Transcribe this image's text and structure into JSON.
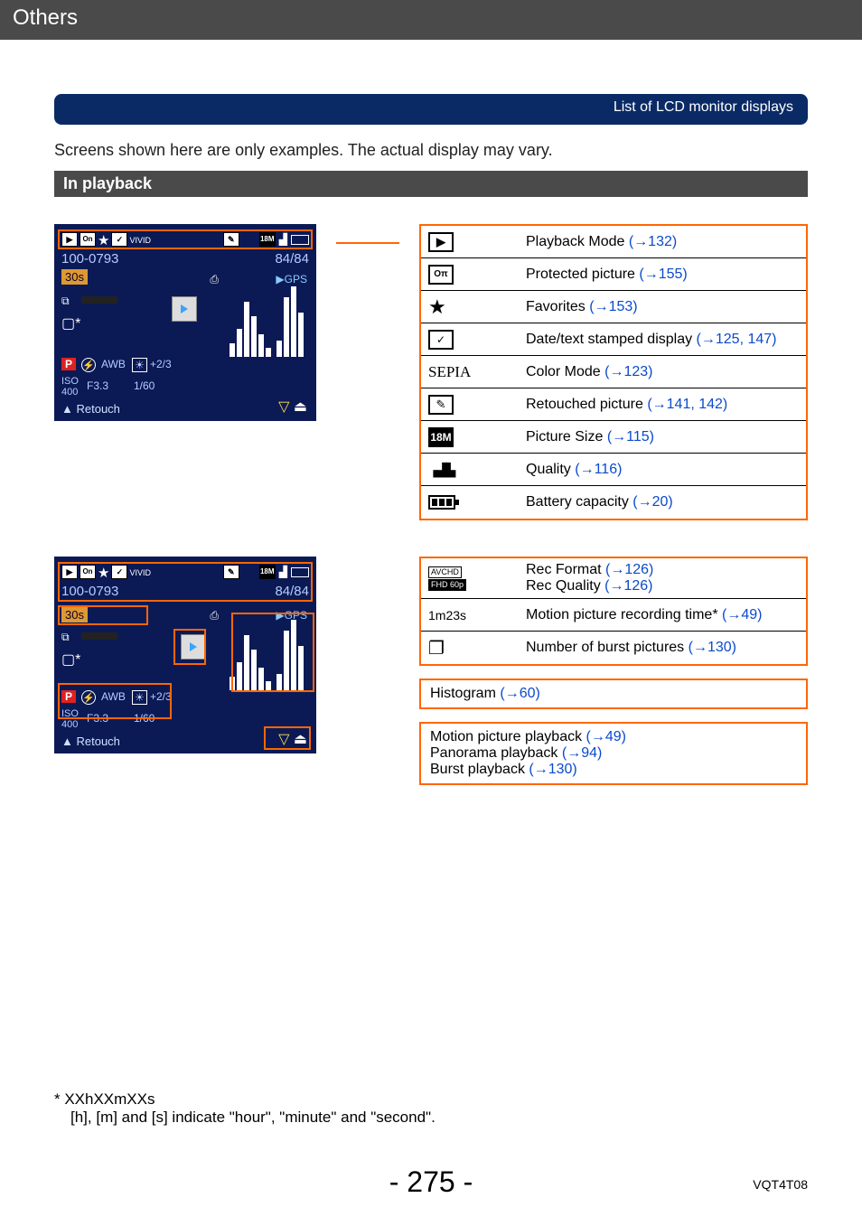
{
  "header": "Others",
  "blueBar": "List of LCD monitor displays",
  "intro": "Screens shown here are only examples. The actual display may vary.",
  "sectionTitle": "In playback",
  "screenshot1": {
    "folder": "100-0793",
    "count": "84/84",
    "duration": "30s",
    "gps": "GPS",
    "mode": "P",
    "awb": "AWB",
    "ev": "+2/3",
    "iso": "400",
    "fnum": "F3.3",
    "shutter": "1/60",
    "retouch": "▲ Retouch",
    "vivid": "VIVID",
    "eighteen": "18M"
  },
  "table1": [
    {
      "iconType": "play",
      "label": "Playback Mode ",
      "ref": "(→132)"
    },
    {
      "iconType": "on",
      "label": "Protected picture ",
      "ref": "(→155)"
    },
    {
      "iconType": "star",
      "label": "Favorites ",
      "ref": "(→153)"
    },
    {
      "iconType": "stamp",
      "label": "Date/text stamped display ",
      "ref": "(→125, 147)"
    },
    {
      "iconType": "sepia",
      "iconText": "SEPIA",
      "label": "Color Mode ",
      "ref": "(→123)"
    },
    {
      "iconType": "retouch",
      "label": "Retouched picture ",
      "ref": "(→141, 142)"
    },
    {
      "iconType": "18m",
      "iconText": "18M",
      "label": "Picture Size ",
      "ref": "(→115)"
    },
    {
      "iconType": "quality",
      "label": "Quality ",
      "ref": "(→116)"
    },
    {
      "iconType": "battery",
      "label": "Battery capacity ",
      "ref": "(→20)"
    }
  ],
  "table2": [
    {
      "iconType": "avchd",
      "iconText1": "AVCHD",
      "iconText2": "FHD 60p",
      "label1": "Rec Format ",
      "ref1": "(→126)",
      "label2": "Rec Quality ",
      "ref2": "(→126)"
    },
    {
      "iconType": "text",
      "iconText": "1m23s",
      "label": "Motion picture recording time* ",
      "ref": "(→49)"
    },
    {
      "iconType": "burst",
      "label": "Number of burst pictures ",
      "ref": "(→130)"
    }
  ],
  "histBox": {
    "label": "Histogram ",
    "ref": "(→60)"
  },
  "playbackBox": [
    {
      "label": "Motion picture playback ",
      "ref": "(→49)"
    },
    {
      "label": "Panorama playback ",
      "ref": "(→94)"
    },
    {
      "label": "Burst playback ",
      "ref": "(→130)"
    }
  ],
  "footnote1": "* XXhXXmXXs",
  "footnote2": "[h], [m] and [s] indicate \"hour\", \"minute\" and \"second\".",
  "pageNum": "- 275 -",
  "docCode": "VQT4T08"
}
